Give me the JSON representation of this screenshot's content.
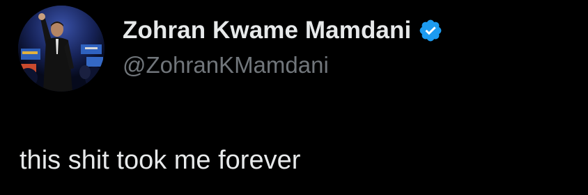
{
  "author": {
    "display_name": "Zohran Kwame Mamdani",
    "handle": "@ZohranKMamdani",
    "verified": true,
    "avatar_icon": "profile-photo",
    "verified_icon": "verified-badge-icon"
  },
  "tweet": {
    "text": "this shit took me forever"
  },
  "colors": {
    "background": "#000000",
    "primary_text": "#e7e9ea",
    "secondary_text": "#71767b",
    "verified_blue": "#1d9bf0"
  }
}
